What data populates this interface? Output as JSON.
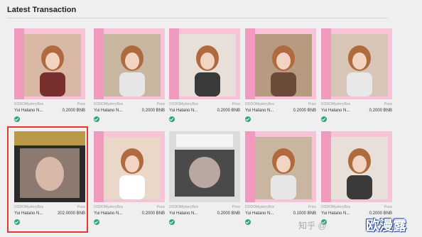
{
  "section": {
    "title": "Latest Transaction"
  },
  "labels": {
    "collection": "DODOMysteryBox",
    "price_label": "Price"
  },
  "cards": [
    {
      "name": "Yui Hatano N...",
      "price": "0.2000 BNB",
      "status": "check-icon",
      "style": "pink"
    },
    {
      "name": "Yui Hatano N...",
      "price": "0.2000 BNB",
      "status": "check-icon",
      "style": "pink"
    },
    {
      "name": "Yui Hatano N...",
      "price": "0.2000 BNB",
      "status": "check-icon",
      "style": "pink"
    },
    {
      "name": "Yui Hatano N...",
      "price": "0.2000 BNB",
      "status": "check-icon",
      "style": "pink"
    },
    {
      "name": "Yui Hatano N...",
      "price": "0.2000 BNB",
      "status": "check-icon",
      "style": "pink"
    },
    {
      "name": "Yui Hatano N...",
      "price": "202.0000 BNB",
      "status": "check-icon",
      "style": "gold",
      "highlighted": true
    },
    {
      "name": "Yui Hatano N...",
      "price": "0.2000 BNB",
      "status": "check-icon",
      "style": "pink"
    },
    {
      "name": "Yui Hatano N...",
      "price": "0.2000 BNB",
      "status": "check-icon",
      "style": "dark"
    },
    {
      "name": "Yui Hatano N...",
      "price": "0.1000 BNB",
      "status": "check-icon",
      "style": "pink"
    },
    {
      "name": "Yui Hatano N...",
      "price": "0.2000 BNB",
      "status": "check-icon",
      "style": "pink"
    }
  ],
  "watermark": {
    "site": "知乎 @",
    "brand": "欧漫露"
  },
  "colors": {
    "check": "#2ea57a",
    "highlight": "#e03a2e",
    "pink": "#f4a6c8"
  }
}
